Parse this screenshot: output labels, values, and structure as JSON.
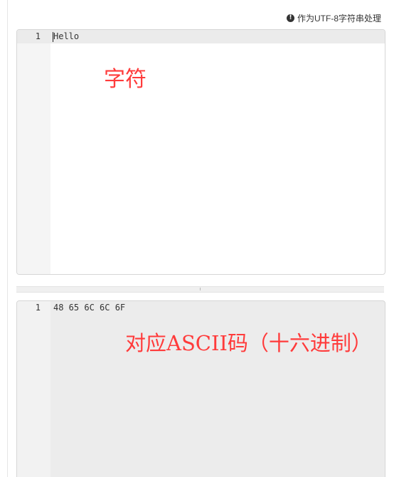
{
  "hint": {
    "icon": "info-icon",
    "text": "作为UTF-8字符串处理"
  },
  "input_editor": {
    "line_number": "1",
    "content": "Hello",
    "annotation": "字符"
  },
  "output_editor": {
    "line_number": "1",
    "content": "48 65 6C 6C 6F",
    "annotation": "对应ASCII码（十六进制）"
  },
  "colors": {
    "annotation": "#ff3b3b",
    "gutter": "#f5f5f5",
    "output_background": "#ececec"
  }
}
